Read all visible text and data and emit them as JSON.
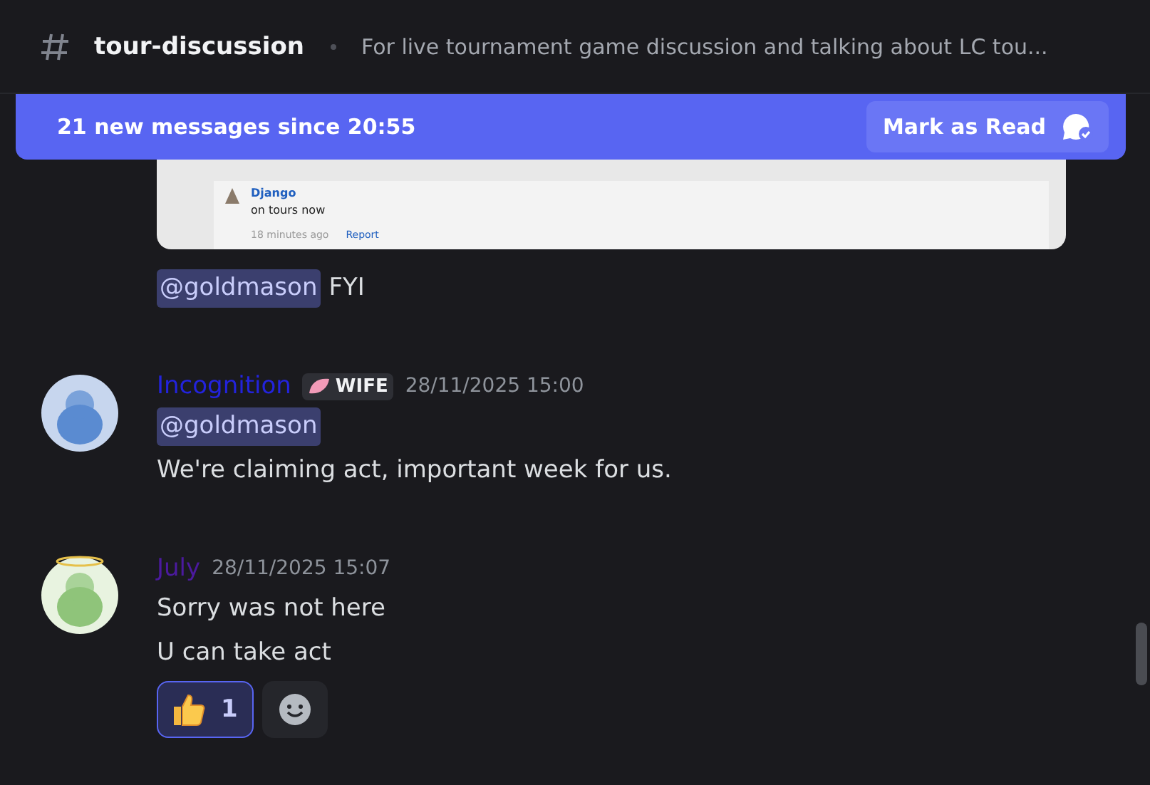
{
  "channel": {
    "name": "tour-discussion",
    "topic": "For live tournament game discussion and talking about LC tou..."
  },
  "new_messages_bar": {
    "text": "21 new messages since 20:55",
    "button": "Mark as Read"
  },
  "embed": {
    "posts": [
      {
        "author": "Django",
        "text": "on tours now",
        "time": "18 minutes ago",
        "action": "Report"
      }
    ]
  },
  "messages": [
    {
      "kind": "continuation",
      "lines": [
        {
          "mention": "@goldmason",
          "text": "FYI"
        }
      ]
    },
    {
      "kind": "full",
      "author": "Incognition",
      "color": "#2323dc",
      "tag": "WIFE",
      "time": "28/11/2025 15:00",
      "lines": [
        {
          "mention": "@goldmason"
        },
        {
          "text": "We're claiming act, important week for us."
        }
      ]
    },
    {
      "kind": "full",
      "author": "July",
      "color": "#4b1a9e",
      "time": "28/11/2025 15:07",
      "lines": [
        {
          "text": "Sorry was not here"
        },
        {
          "text": "U can take act"
        }
      ],
      "reactions": [
        {
          "count": "1",
          "selected": true
        }
      ]
    }
  ]
}
